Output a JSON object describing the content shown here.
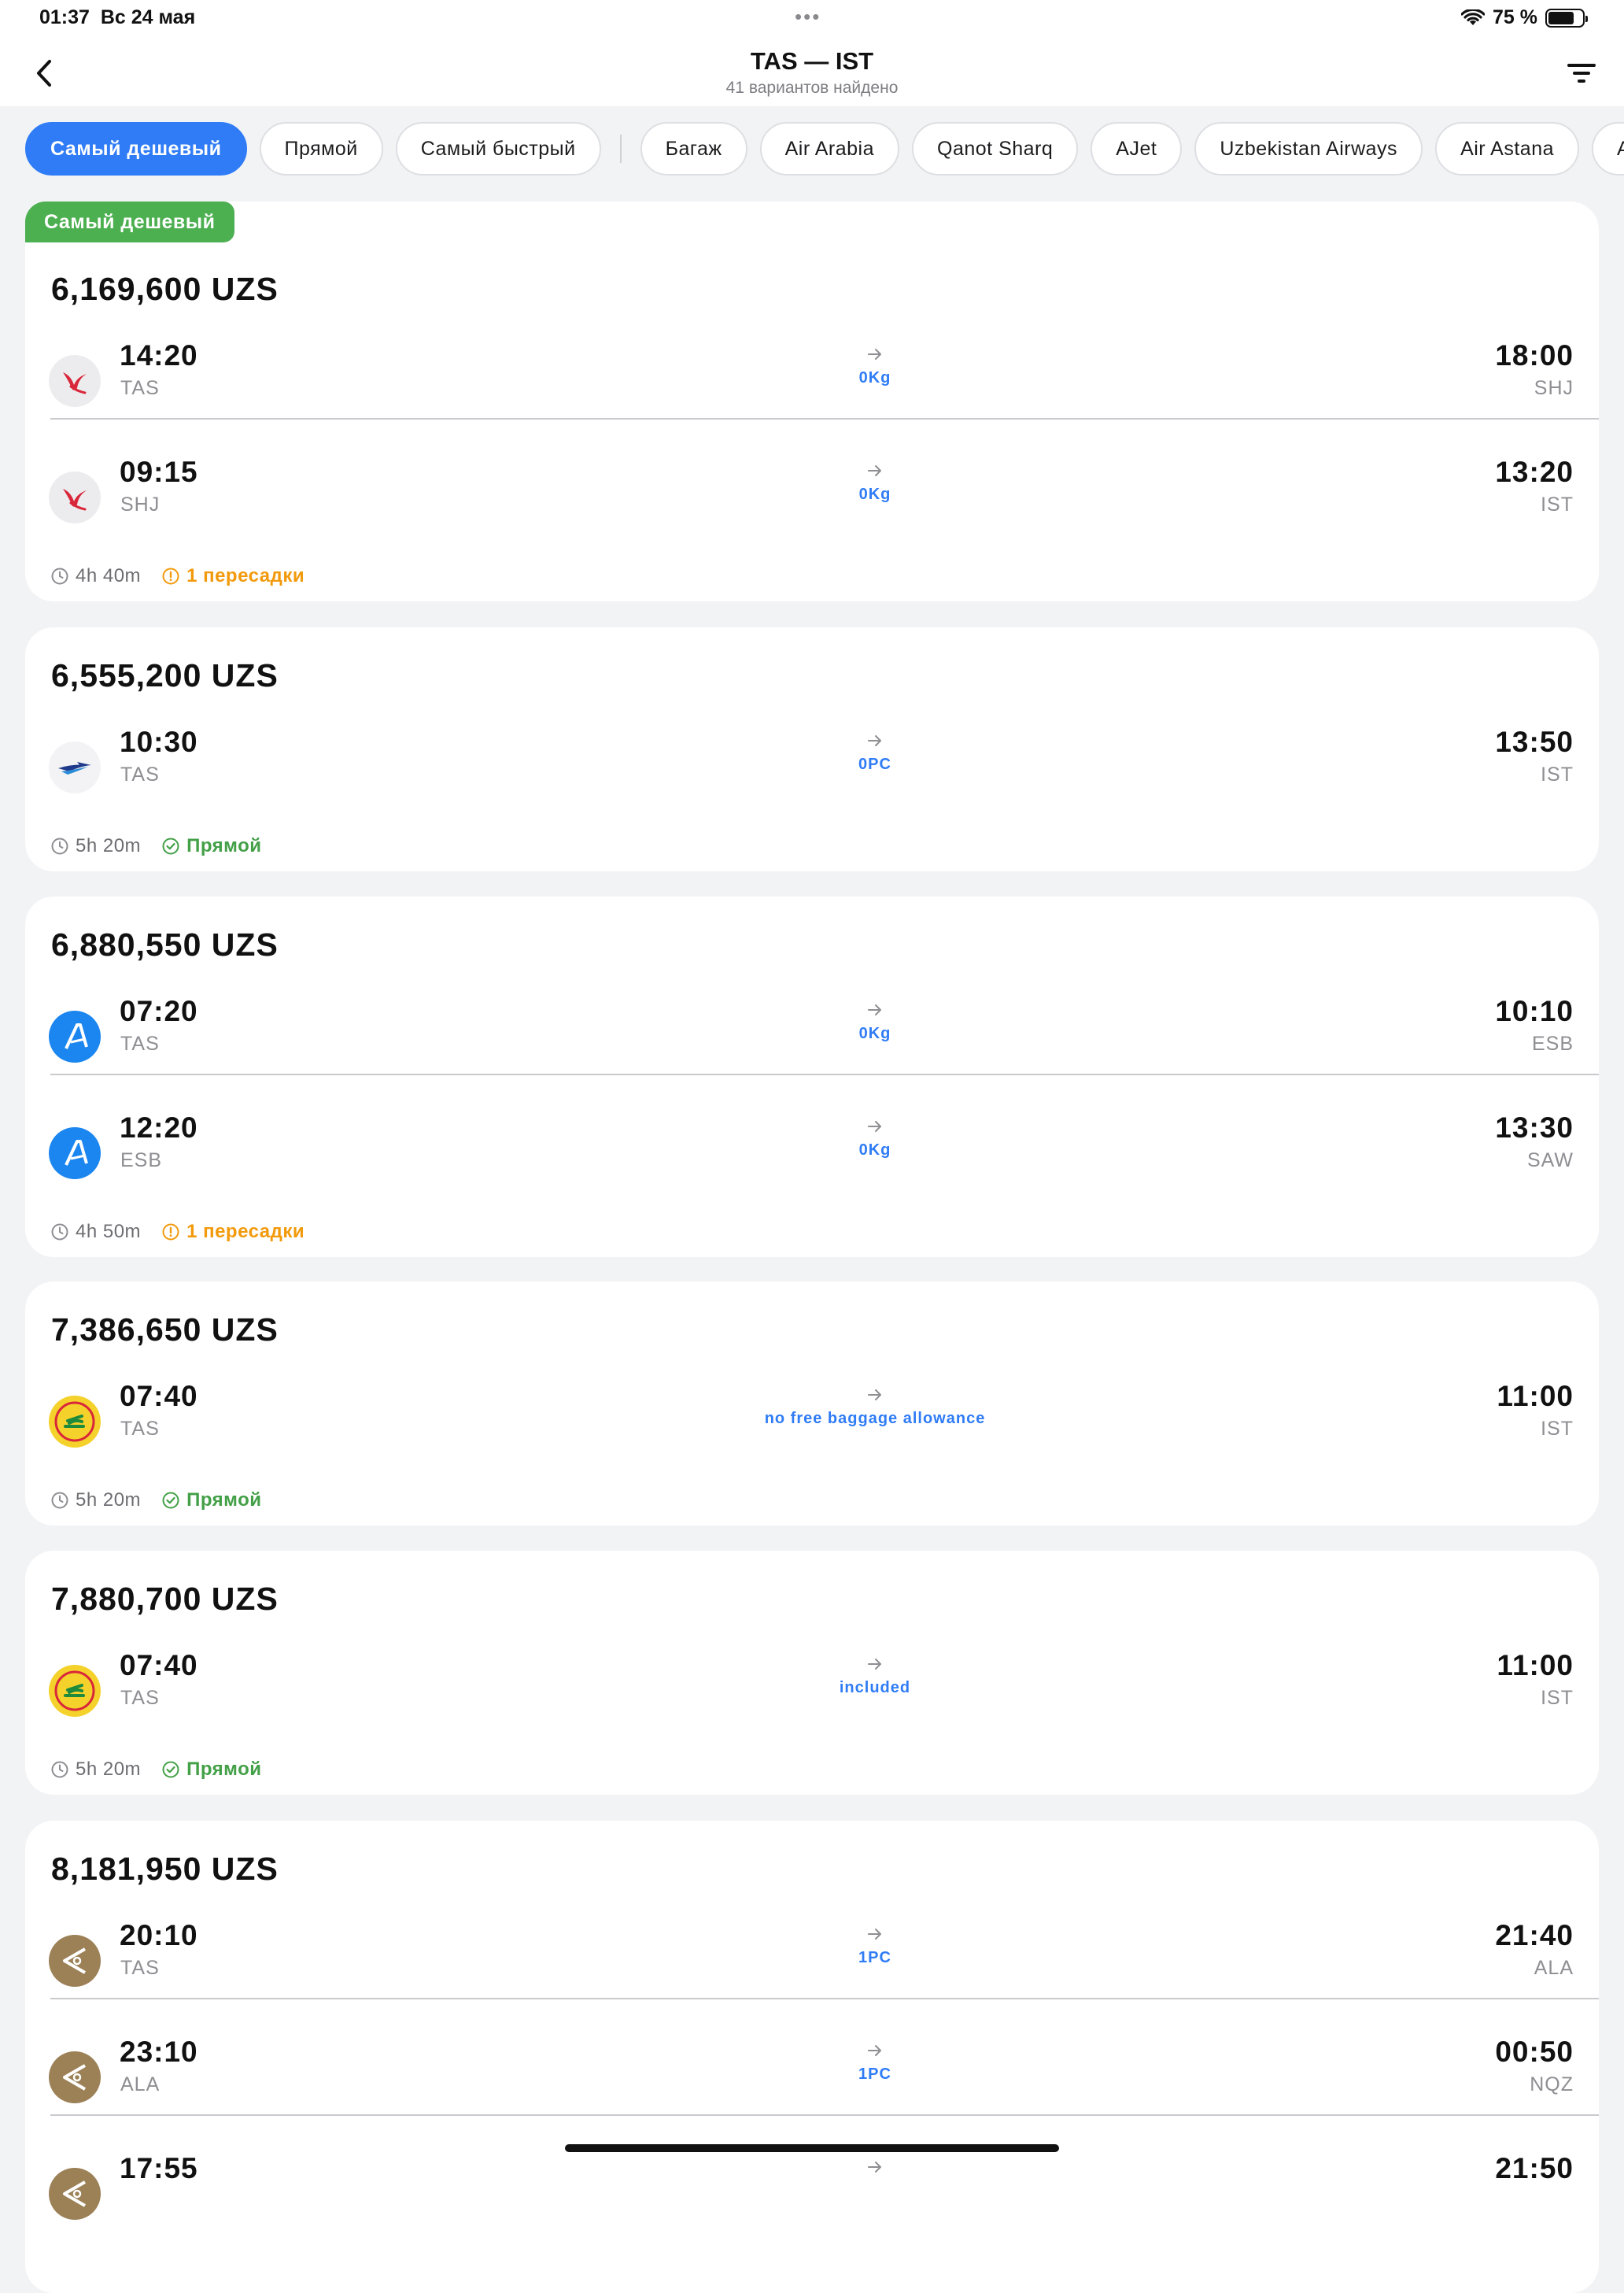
{
  "status_bar": {
    "time": "01:37",
    "date": "Вс 24 мая",
    "battery": "75 %",
    "battery_level": 0.75
  },
  "header": {
    "title": "TAS — IST",
    "subtitle": "41 вариантов найдено"
  },
  "chips": [
    {
      "label": "Самый дешевый",
      "active": true
    },
    {
      "label": "Прямой"
    },
    {
      "label": "Самый быстрый"
    },
    {
      "label": "Багаж"
    },
    {
      "label": "Air Arabia"
    },
    {
      "label": "Qanot Sharq"
    },
    {
      "label": "AJet"
    },
    {
      "label": "Uzbekistan Airways"
    },
    {
      "label": "Air Astana"
    },
    {
      "label": "A"
    }
  ],
  "badge": "Самый дешевый",
  "colors": {
    "accent": "#2f7cf6",
    "badge_green": "#4caf50",
    "direct_green": "#43a047",
    "transfer_orange": "#f29a0c"
  },
  "results": [
    {
      "price": "6,169,600 UZS",
      "legs": [
        {
          "logo": "air-arabia-logo",
          "dep_time": "14:20",
          "dep_code": "TAS",
          "arr_time": "18:00",
          "arr_code": "SHJ",
          "baggage": "0Kg"
        },
        {
          "logo": "air-arabia-logo",
          "dep_time": "09:15",
          "dep_code": "SHJ",
          "arr_time": "13:20",
          "arr_code": "IST",
          "baggage": "0Kg"
        }
      ],
      "duration": "4h 40m",
      "stops": "1 пересадки",
      "stops_type": "transfer"
    },
    {
      "price": "6,555,200 UZS",
      "legs": [
        {
          "logo": "uzbekistan-airways-logo",
          "dep_time": "10:30",
          "dep_code": "TAS",
          "arr_time": "13:50",
          "arr_code": "IST",
          "baggage": "0PC"
        }
      ],
      "duration": "5h 20m",
      "stops": "Прямой",
      "stops_type": "direct"
    },
    {
      "price": "6,880,550 UZS",
      "legs": [
        {
          "logo": "ajet-logo",
          "dep_time": "07:20",
          "dep_code": "TAS",
          "arr_time": "10:10",
          "arr_code": "ESB",
          "baggage": "0Kg"
        },
        {
          "logo": "ajet-logo",
          "dep_time": "12:20",
          "dep_code": "ESB",
          "arr_time": "13:30",
          "arr_code": "SAW",
          "baggage": "0Kg"
        }
      ],
      "duration": "4h 50m",
      "stops": "1 пересадки",
      "stops_type": "transfer"
    },
    {
      "price": "7,386,650 UZS",
      "legs": [
        {
          "logo": "qanot-sharq-logo",
          "dep_time": "07:40",
          "dep_code": "TAS",
          "arr_time": "11:00",
          "arr_code": "IST",
          "baggage": "no free baggage allowance"
        }
      ],
      "duration": "5h 20m",
      "stops": "Прямой",
      "stops_type": "direct"
    },
    {
      "price": "7,880,700 UZS",
      "legs": [
        {
          "logo": "qanot-sharq-logo",
          "dep_time": "07:40",
          "dep_code": "TAS",
          "arr_time": "11:00",
          "arr_code": "IST",
          "baggage": "included"
        }
      ],
      "duration": "5h 20m",
      "stops": "Прямой",
      "stops_type": "direct"
    },
    {
      "price": "8,181,950 UZS",
      "legs": [
        {
          "logo": "air-astana-logo",
          "dep_time": "20:10",
          "dep_code": "TAS",
          "arr_time": "21:40",
          "arr_code": "ALA",
          "baggage": "1PC"
        },
        {
          "logo": "air-astana-logo",
          "dep_time": "23:10",
          "dep_code": "ALA",
          "arr_time": "00:50",
          "arr_code": "NQZ",
          "baggage": "1PC"
        },
        {
          "logo": "air-astana-logo",
          "dep_time": "17:55",
          "dep_code": "",
          "arr_time": "21:50",
          "arr_code": "",
          "baggage": ""
        }
      ],
      "duration": "",
      "stops": "",
      "stops_type": ""
    }
  ]
}
